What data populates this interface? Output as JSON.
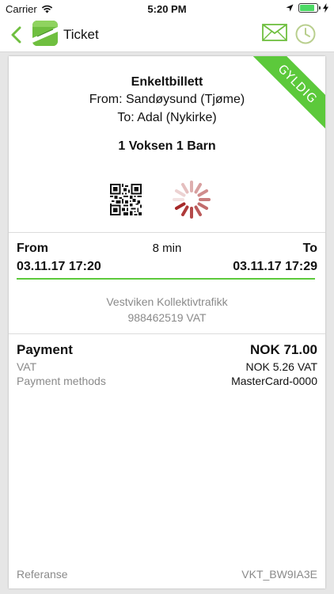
{
  "status_bar": {
    "carrier": "Carrier",
    "time": "5:20 PM",
    "battery_level": 0.85
  },
  "nav": {
    "title": "Ticket",
    "icons": [
      "back-chevron-icon",
      "app-logo-icon",
      "mail-icon",
      "clock-icon"
    ],
    "accent_color": "#6fbf3f"
  },
  "ticket": {
    "status_ribbon": "GYLDIG",
    "type": "Enkeltbillett",
    "from": "From: Sandøysund (Tjøme)",
    "to": "To: Adal (Nykirke)",
    "passengers": "1 Voksen 1 Barn"
  },
  "trip": {
    "from_label": "From",
    "to_label": "To",
    "duration": "8 min",
    "departure": "03.11.17 17:20",
    "arrival": "03.11.17 17:29"
  },
  "operator": {
    "name": "Vestviken Kollektivtrafikk",
    "org_number": "988462519 VAT"
  },
  "payment": {
    "label": "Payment",
    "total": "NOK 71.00",
    "vat_label": "VAT",
    "vat_value": "NOK 5.26 VAT",
    "methods_label": "Payment methods",
    "methods_value": "MasterCard-0000"
  },
  "reference": {
    "label": "Referanse",
    "value": "VKT_BW9IA3E"
  }
}
